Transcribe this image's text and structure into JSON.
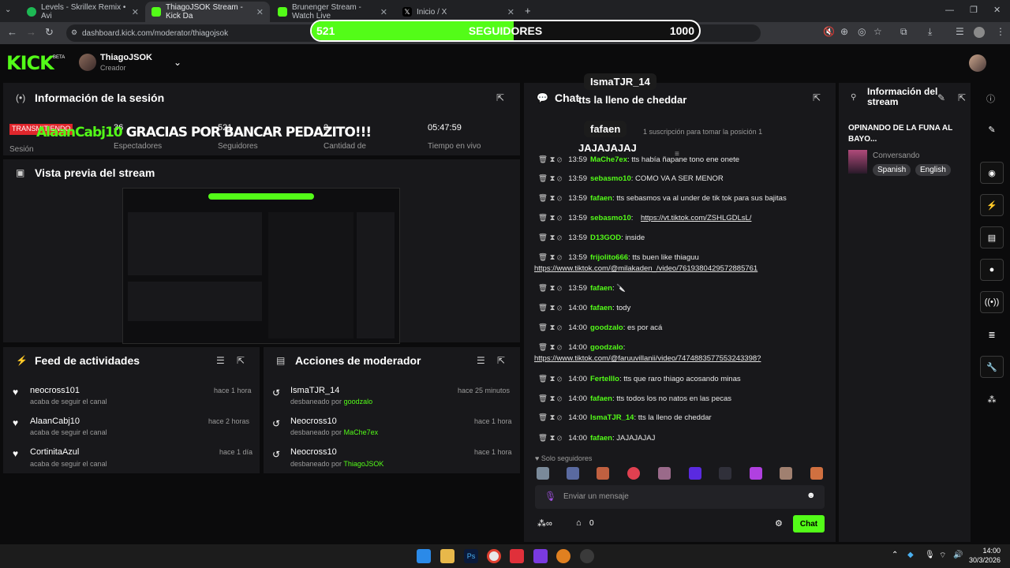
{
  "browser": {
    "tabs": [
      {
        "title": "Levels - Skrillex Remix • Avi",
        "active": false,
        "icon_color": "#1db954"
      },
      {
        "title": "ThiagoJSOK Stream - Kick Da",
        "active": true,
        "icon_color": "#53fc18"
      },
      {
        "title": "Brunenger Stream - Watch Live",
        "active": false,
        "icon_color": "#53fc18"
      },
      {
        "title": "Inicio / X",
        "active": false,
        "icon_color": "#ffffff"
      }
    ],
    "url": "dashboard.kick.com/moderator/thiagojsok"
  },
  "follower_goal": {
    "current": "521",
    "label": "SEGUIDORES",
    "target": "1000",
    "progress": 0.521
  },
  "header": {
    "logo": "KICK",
    "beta": "BETA",
    "username": "ThiagoJSOK",
    "role": "Creador"
  },
  "session_info": {
    "title": "Información de la sesión",
    "live_badge": "TRANSMITIENDO",
    "stats": [
      {
        "value": "36",
        "label": "Espectadores"
      },
      {
        "value": "521",
        "label": "Seguidores"
      },
      {
        "value": "2",
        "label": "Cantidad de"
      },
      {
        "value": "05:47:59",
        "label": "Tiempo en vivo"
      }
    ],
    "first_label": "Sesión"
  },
  "donation_overlay": {
    "user": "AlaanCabj10",
    "text": "GRACIAS POR BANCAR PEDAZITO!!!"
  },
  "preview": {
    "title": "Vista previa del stream"
  },
  "feed": {
    "title": "Feed de actividades",
    "items": [
      {
        "name": "neocross101",
        "sub": "acaba de seguir el canal",
        "time": "hace 1 hora"
      },
      {
        "name": "AlaanCabj10",
        "sub": "acaba de seguir el canal",
        "time": "hace 2 horas"
      },
      {
        "name": "CortinitaAzul",
        "sub": "acaba de seguir el canal",
        "time": "hace 1 día"
      }
    ]
  },
  "mod_actions": {
    "title": "Acciones de moderador",
    "items": [
      {
        "name": "IsmaTJR_14",
        "sub": "desbaneado por",
        "by": "goodzalo",
        "by_color": "#53fc18",
        "time": "hace 25 minutos"
      },
      {
        "name": "Neocross10",
        "sub": "desbaneado por",
        "by": "MaChe7ex",
        "by_color": "#53fc18",
        "time": "hace 1 hora"
      },
      {
        "name": "Neocross10",
        "sub": "desbaneado por",
        "by": "ThiagoJSOK",
        "by_color": "#53fc18",
        "time": "hace 1 hora"
      }
    ]
  },
  "chat": {
    "title": "Chat",
    "sub_notice": "1 suscripción para tomar la posición 1",
    "messages": [
      {
        "time": "13:59",
        "user": "MaChe7ex",
        "color": "#53fc18",
        "text": "tts había ñapane tono ene onete"
      },
      {
        "time": "13:59",
        "user": "sebasmo10",
        "color": "#53fc18",
        "text": "COMO VA A SER MENOR"
      },
      {
        "time": "13:59",
        "user": "fafaen",
        "color": "#53fc18",
        "text": "tts sebasmos va al under de tik tok para sus bajitas"
      },
      {
        "time": "13:59",
        "user": "sebasmo10",
        "color": "#53fc18",
        "text": "",
        "link": "https://vt.tiktok.com/ZSHLGDLsL/"
      },
      {
        "time": "13:59",
        "user": "D13GOD",
        "color": "#53fc18",
        "text": "inside"
      },
      {
        "time": "13:59",
        "user": "frijolito666",
        "color": "#53fc18",
        "text": "tts buen like thiaguu",
        "link": "https://www.tiktok.com/@milakaden_/video/7619380429572885761"
      },
      {
        "time": "13:59",
        "user": "fafaen",
        "color": "#53fc18",
        "text": "🔪"
      },
      {
        "time": "14:00",
        "user": "fafaen",
        "color": "#53fc18",
        "text": "tody"
      },
      {
        "time": "14:00",
        "user": "goodzalo",
        "color": "#53fc18",
        "text": "es por acá"
      },
      {
        "time": "14:00",
        "user": "goodzalo",
        "color": "#53fc18",
        "text": "",
        "link": "https://www.tiktok.com/@faruuvillanii/video/7474883577553243398?"
      },
      {
        "time": "14:00",
        "user": "Fertelllo",
        "color": "#53fc18",
        "text": "tts que raro thiago acosando minas"
      },
      {
        "time": "14:00",
        "user": "fafaen",
        "color": "#53fc18",
        "text": "tts todos los no natos en las pecas"
      },
      {
        "time": "14:00",
        "user": "IsmaTJR_14",
        "color": "#53fc18",
        "text": "tts la lleno de cheddar"
      },
      {
        "time": "14:00",
        "user": "fafaen",
        "color": "#53fc18",
        "text": "JAJAJAJAJ"
      }
    ],
    "followers_only": "Solo seguidores",
    "input_placeholder": "Enviar un mensaje",
    "viewer_count": "0",
    "send_label": "Chat"
  },
  "tts_overlay": [
    {
      "user": "IsmaTJR_14",
      "text": "tts la lleno de cheddar"
    },
    {
      "user": "fafaen",
      "text": "JAJAJAJAJ"
    }
  ],
  "stream_info": {
    "title": "Información del stream",
    "stream_title": "OPINANDO DE LA FUNA AL BAYO...",
    "category": "Conversando",
    "tags": [
      "Spanish",
      "English"
    ]
  },
  "taskbar": {
    "time": "14:00",
    "date": "30/3/2026"
  }
}
